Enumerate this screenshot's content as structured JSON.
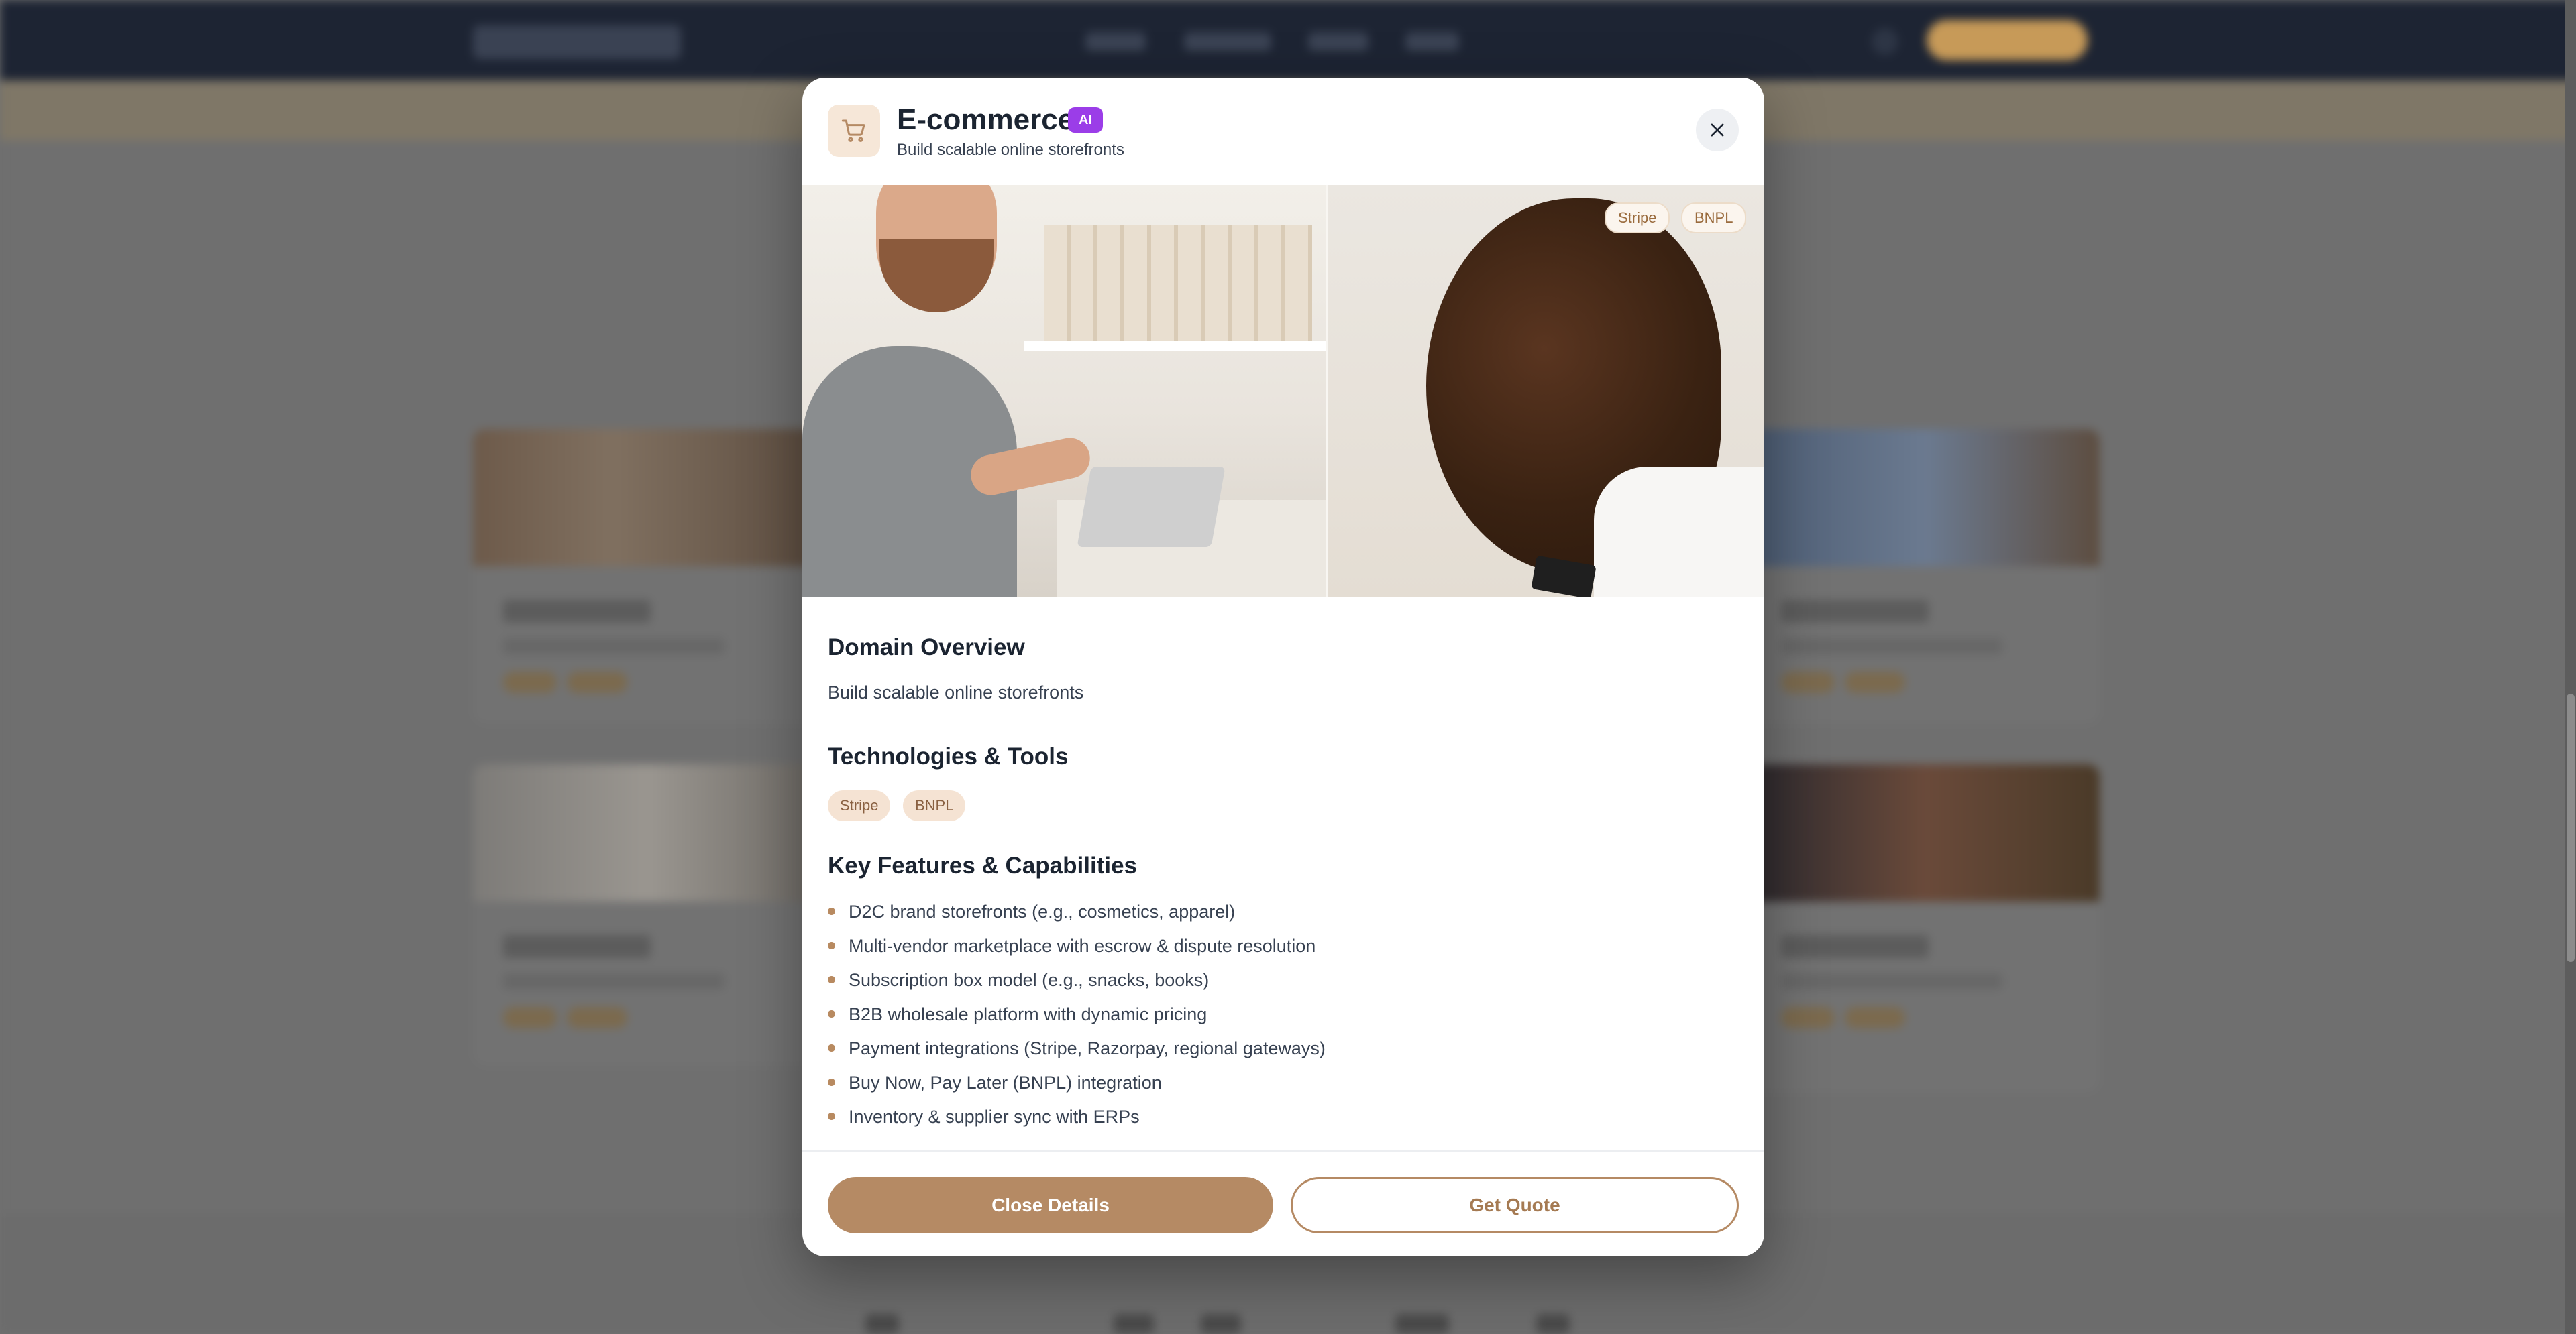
{
  "modal": {
    "title": "E-commerce",
    "badge": "AI",
    "subtitle": "Build scalable online storefronts",
    "hero_tags": [
      "Stripe",
      "BNPL"
    ],
    "overview_heading": "Domain Overview",
    "overview_text": "Build scalable online storefronts",
    "tech_heading": "Technologies & Tools",
    "tech_tags": [
      "Stripe",
      "BNPL"
    ],
    "features_heading": "Key Features & Capabilities",
    "features": [
      "D2C brand storefronts (e.g., cosmetics, apparel)",
      "Multi-vendor marketplace with escrow & dispute resolution",
      "Subscription box model (e.g., snacks, books)",
      "B2B wholesale platform with dynamic pricing",
      "Payment integrations (Stripe, Razorpay, regional gateways)",
      "Buy Now, Pay Later (BNPL) integration",
      "Inventory & supplier sync with ERPs"
    ],
    "close_button": "Close Details",
    "quote_button": "Get Quote"
  },
  "icons": {
    "header": "shopping-cart-icon",
    "close": "close-icon"
  },
  "colors": {
    "accent": "#b58a64",
    "ai_badge": "#9b3de8",
    "nav_bg": "#1d2433"
  }
}
